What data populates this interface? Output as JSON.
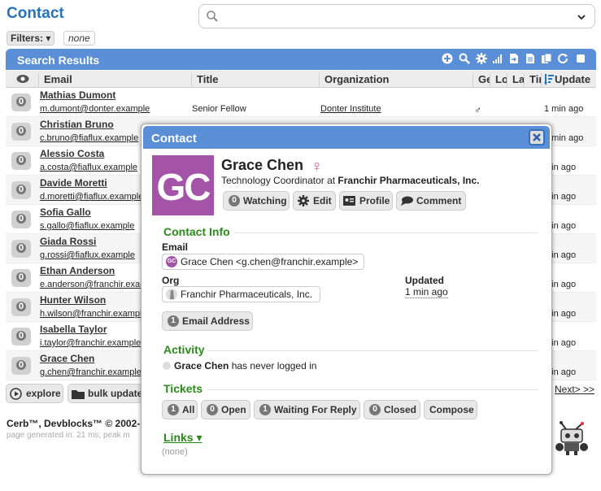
{
  "page": {
    "title": "Contact",
    "search": {
      "placeholder": "",
      "value": ""
    },
    "filters_label": "Filters:",
    "filters_value": "none"
  },
  "results": {
    "title": "Search Results",
    "columns": [
      "Email",
      "Title",
      "Organization",
      "Ge",
      "Lo",
      "La",
      "Tim",
      "Update"
    ],
    "rows": [
      {
        "badge": "0",
        "name": "Mathias Dumont",
        "email": "m.dumont@donter.example",
        "title": "Senior Fellow",
        "org": "Donter Institute",
        "gender": "♂",
        "updated": "1 min ago"
      },
      {
        "badge": "0",
        "name": "Christian Bruno",
        "email": "c.bruno@fiaflux.example",
        "title": "",
        "org": "",
        "gender": "",
        "updated": "1 min ago"
      },
      {
        "badge": "0",
        "name": "Alessio Costa",
        "email": "a.costa@fiaflux.example",
        "title": "",
        "org": "",
        "gender": "",
        "updated": "min ago"
      },
      {
        "badge": "0",
        "name": "Davide Moretti",
        "email": "d.moretti@fiaflux.example",
        "title": "",
        "org": "",
        "gender": "",
        "updated": "min ago"
      },
      {
        "badge": "0",
        "name": "Sofia Gallo",
        "email": "s.gallo@fiaflux.example",
        "title": "",
        "org": "",
        "gender": "",
        "updated": "min ago"
      },
      {
        "badge": "0",
        "name": "Giada Rossi",
        "email": "g.rossi@fiaflux.example",
        "title": "",
        "org": "",
        "gender": "",
        "updated": "min ago"
      },
      {
        "badge": "0",
        "name": "Ethan Anderson",
        "email": "e.anderson@franchir.example",
        "title": "",
        "org": "",
        "gender": "",
        "updated": "min ago"
      },
      {
        "badge": "0",
        "name": "Hunter Wilson",
        "email": "h.wilson@franchir.example",
        "title": "",
        "org": "",
        "gender": "",
        "updated": "min ago"
      },
      {
        "badge": "0",
        "name": "Isabella Taylor",
        "email": "i.taylor@franchir.example",
        "title": "",
        "org": "",
        "gender": "",
        "updated": "min ago"
      },
      {
        "badge": "0",
        "name": "Grace Chen",
        "email": "g.chen@franchir.example",
        "title": "",
        "org": "",
        "gender": "",
        "updated": "min ago"
      }
    ],
    "explore_label": "explore",
    "bulk_label": "bulk update",
    "pager_next": "Next>",
    "pager_last": ">>"
  },
  "footer": {
    "brand": "Cerb™, Devblocks™ © 2002-",
    "generated": "page generated in: 21 ms; peak m"
  },
  "modal": {
    "title": "Contact",
    "initials": "GC",
    "name": "Grace Chen",
    "gender_symbol": "♀",
    "job_prefix": "Technology Coordinator at ",
    "job_org": "Franchir Pharmaceuticals, Inc.",
    "buttons": {
      "watching_count": "0",
      "watching": "Watching",
      "edit": "Edit",
      "profile": "Profile",
      "comment": "Comment"
    },
    "contact_info": {
      "heading": "Contact Info",
      "email_label": "Email",
      "email_value": "Grace Chen <g.chen@franchir.example>",
      "org_label": "Org",
      "org_value": "Franchir Pharmaceuticals, Inc.",
      "updated_label": "Updated",
      "updated_value": "1 min ago",
      "email_address_count": "1",
      "email_address_label": "Email Address"
    },
    "activity": {
      "heading": "Activity",
      "name": "Grace Chen",
      "text": " has never logged in"
    },
    "tickets": {
      "heading": "Tickets",
      "all_count": "1",
      "all": "All",
      "open_count": "0",
      "open": "Open",
      "waiting_count": "1",
      "waiting": "Waiting For Reply",
      "closed_count": "0",
      "closed": "Closed",
      "compose": "Compose"
    },
    "links": {
      "heading": "Links",
      "value": "(none)"
    }
  },
  "colors": {
    "header_blue": "#5a8fd8",
    "title_blue": "#2673b9",
    "section_green": "#2a8a1a",
    "avatar_purple": "#a354a8",
    "female_pink": "#e24aa0"
  }
}
